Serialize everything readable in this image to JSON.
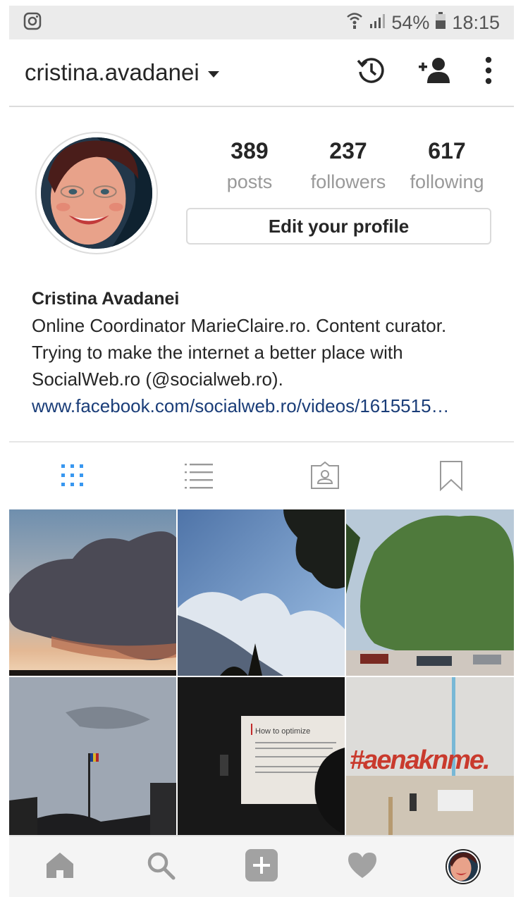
{
  "status_bar": {
    "battery": "54%",
    "time": "18:15"
  },
  "header": {
    "username": "cristina.avadanei"
  },
  "stats": [
    {
      "value": "389",
      "label": "posts"
    },
    {
      "value": "237",
      "label": "followers"
    },
    {
      "value": "617",
      "label": "following"
    }
  ],
  "edit_button": "Edit your profile",
  "bio": {
    "name": "Cristina Avadanei",
    "line1": "Online Coordinator MarieClaire.ro. Content curator.",
    "line2": "Trying to make the internet a better place with",
    "line3": "SocialWeb.ro (@socialweb.ro).",
    "link": "www.facebook.com/socialweb.ro/videos/1615515…"
  },
  "posts": {
    "slide_title": "How to optimize",
    "sign_text": "#aenaknme."
  },
  "colors": {
    "active_tab": "#3897f0",
    "link": "#1a3d78",
    "inactive": "#999999"
  }
}
